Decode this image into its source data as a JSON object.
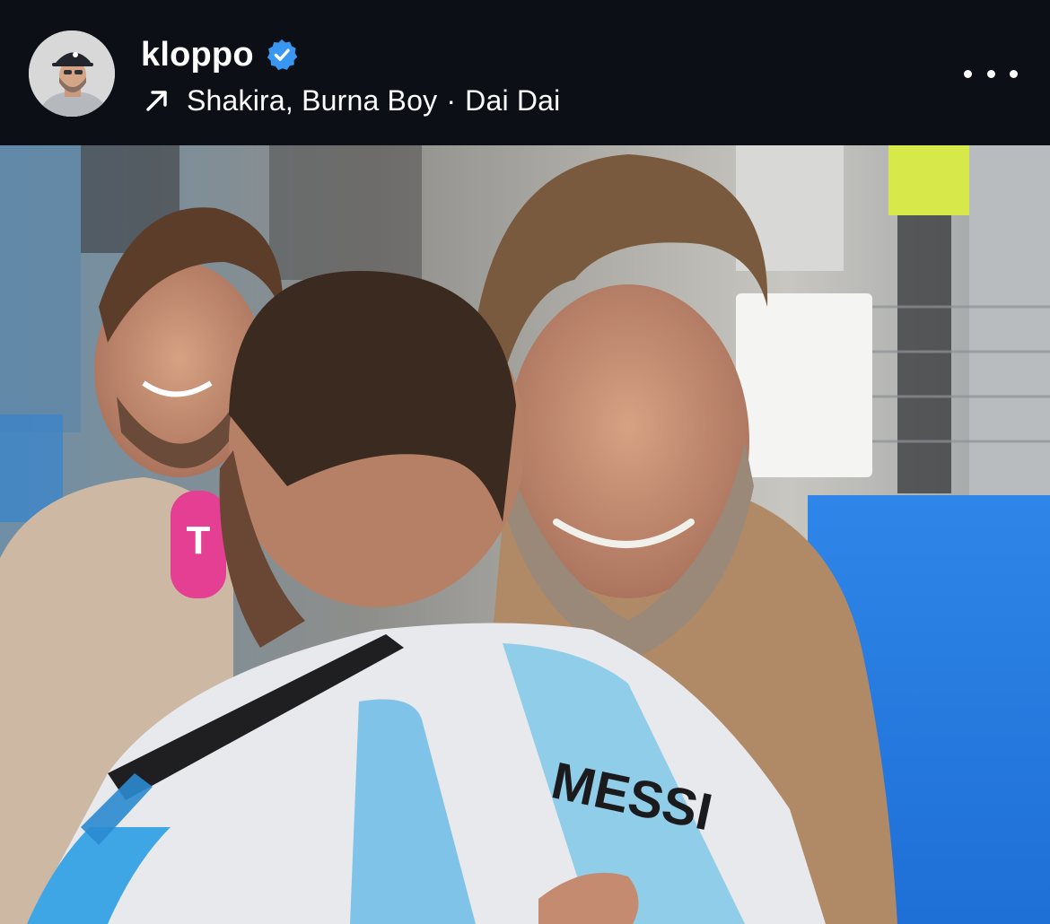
{
  "post_header": {
    "username": "kloppo",
    "verified": true,
    "music": {
      "icon": "arrow-up-right-icon",
      "artists": "Shakira, Burna Boy",
      "separator": "·",
      "song": "Dai Dai"
    },
    "more_icon": "more-horizontal-icon"
  },
  "photo": {
    "jersey_name": "MESSI",
    "mic_logo": "T"
  },
  "colors": {
    "background": "#0d0f17",
    "text": "#ffffff",
    "verified_badge": "#3897f0"
  }
}
